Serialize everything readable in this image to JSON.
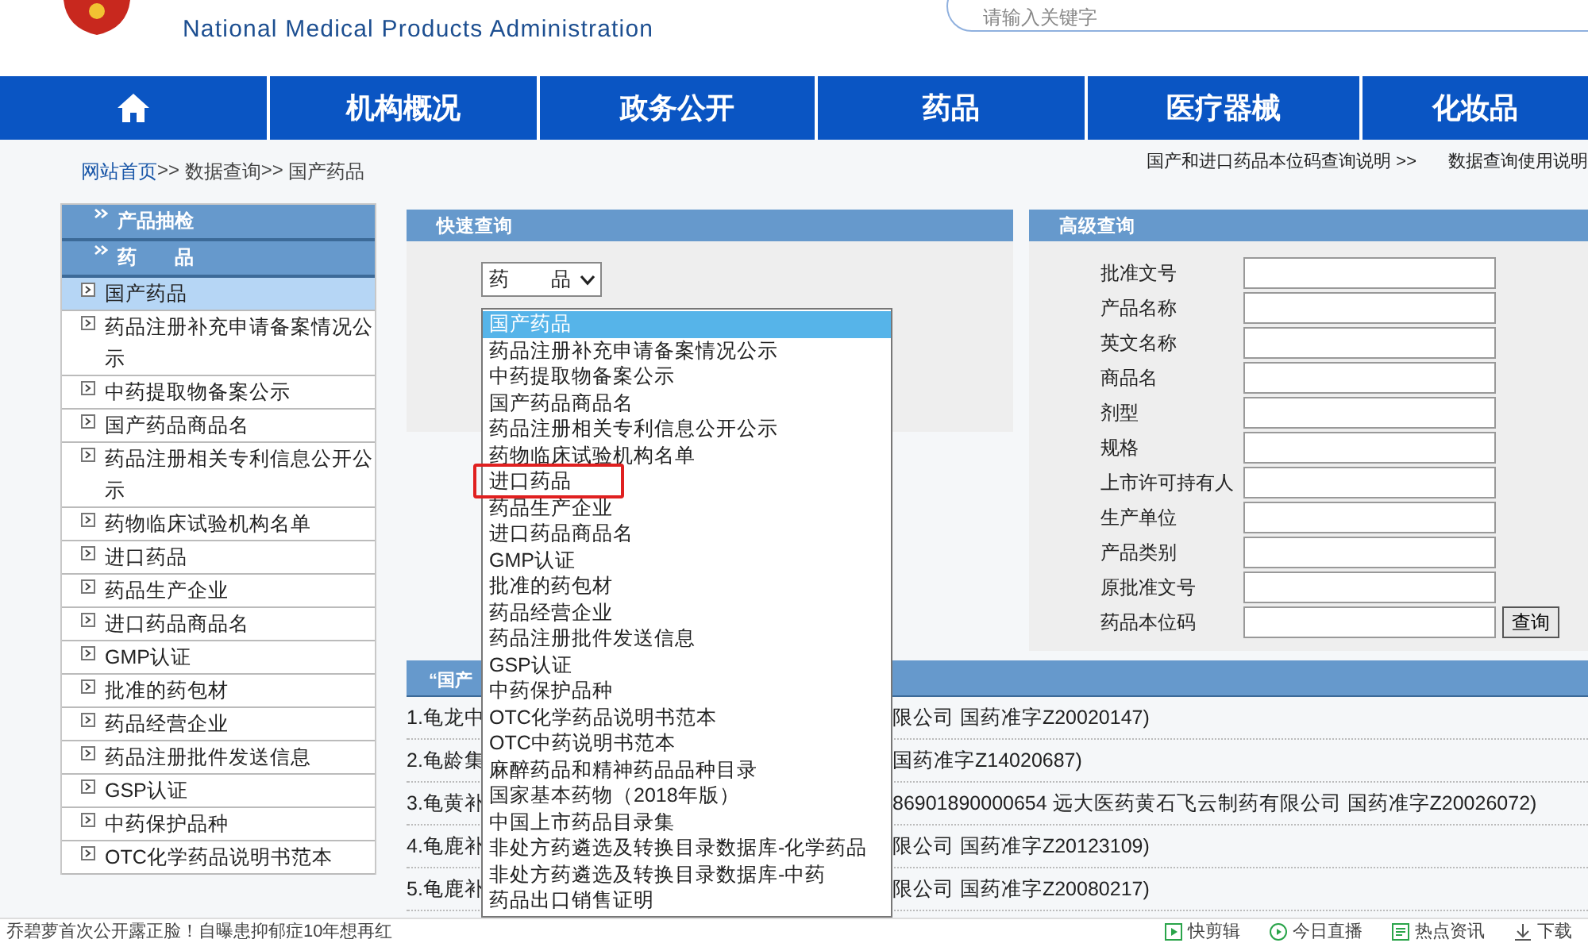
{
  "header": {
    "subtitle": "National Medical Products Administration",
    "search": {
      "placeholder": "请输入关键字"
    }
  },
  "nav": [
    {
      "kind": "home"
    },
    {
      "kind": "text",
      "label": "机构概况"
    },
    {
      "kind": "text",
      "label": "政务公开"
    },
    {
      "kind": "text",
      "label": "药品"
    },
    {
      "kind": "text",
      "label": "医疗器械"
    },
    {
      "kind": "text",
      "label": "化妆品"
    }
  ],
  "breadcrumb": {
    "separator": ">>",
    "items": [
      {
        "label": "网站首页",
        "link": true
      },
      {
        "label": "数据查询",
        "link": false
      },
      {
        "label": "国产药品",
        "link": false
      }
    ]
  },
  "help_links": [
    "国产和进口药品本位码查询说明 >>",
    "数据查询使用说明"
  ],
  "sidebar": {
    "sections": [
      "产品抽检",
      "药　　品"
    ],
    "items": [
      {
        "label": "国产药品",
        "selected": true
      },
      {
        "label": "药品注册补充申请备案情况公示",
        "selected": false
      },
      {
        "label": "中药提取物备案公示",
        "selected": false
      },
      {
        "label": "国产药品商品名",
        "selected": false
      },
      {
        "label": "药品注册相关专利信息公开公示",
        "selected": false
      },
      {
        "label": "药物临床试验机构名单",
        "selected": false
      },
      {
        "label": "进口药品",
        "selected": false
      },
      {
        "label": "药品生产企业",
        "selected": false
      },
      {
        "label": "进口药品商品名",
        "selected": false
      },
      {
        "label": "GMP认证",
        "selected": false
      },
      {
        "label": "批准的药包材",
        "selected": false
      },
      {
        "label": "药品经营企业",
        "selected": false
      },
      {
        "label": "药品注册批件发送信息",
        "selected": false
      },
      {
        "label": "GSP认证",
        "selected": false
      },
      {
        "label": "中药保护品种",
        "selected": false
      },
      {
        "label": "OTC化学药品说明书范本",
        "selected": false
      }
    ]
  },
  "quick_search": {
    "title": "快速查询",
    "select": {
      "value": "药　　品",
      "expanded": true
    },
    "options": [
      {
        "label": "国产药品",
        "selected": true,
        "marked": false
      },
      {
        "label": "药品注册补充申请备案情况公示",
        "selected": false,
        "marked": false
      },
      {
        "label": "中药提取物备案公示",
        "selected": false,
        "marked": false
      },
      {
        "label": "国产药品商品名",
        "selected": false,
        "marked": false
      },
      {
        "label": "药品注册相关专利信息公开公示",
        "selected": false,
        "marked": false
      },
      {
        "label": "药物临床试验机构名单",
        "selected": false,
        "marked": false
      },
      {
        "label": "进口药品",
        "selected": false,
        "marked": true
      },
      {
        "label": "药品生产企业",
        "selected": false,
        "marked": false
      },
      {
        "label": "进口药品商品名",
        "selected": false,
        "marked": false
      },
      {
        "label": "GMP认证",
        "selected": false,
        "marked": false
      },
      {
        "label": "批准的药包材",
        "selected": false,
        "marked": false
      },
      {
        "label": "药品经营企业",
        "selected": false,
        "marked": false
      },
      {
        "label": "药品注册批件发送信息",
        "selected": false,
        "marked": false
      },
      {
        "label": "GSP认证",
        "selected": false,
        "marked": false
      },
      {
        "label": "中药保护品种",
        "selected": false,
        "marked": false
      },
      {
        "label": "OTC化学药品说明书范本",
        "selected": false,
        "marked": false
      },
      {
        "label": "OTC中药说明书范本",
        "selected": false,
        "marked": false
      },
      {
        "label": "麻醉药品和精神药品品种目录",
        "selected": false,
        "marked": false
      },
      {
        "label": "国家基本药物（2018年版）",
        "selected": false,
        "marked": false
      },
      {
        "label": "中国上市药品目录集",
        "selected": false,
        "marked": false
      },
      {
        "label": "非处方药遴选及转换目录数据库-化学药品",
        "selected": false,
        "marked": false
      },
      {
        "label": "非处方药遴选及转换目录数据库-中药",
        "selected": false,
        "marked": false
      },
      {
        "label": "药品出口销售证明",
        "selected": false,
        "marked": false
      }
    ]
  },
  "advanced_search": {
    "title": "高级查询",
    "fields": [
      "批准文号",
      "产品名称",
      "英文名称",
      "商品名",
      "剂型",
      "规格",
      "上市许可持有人",
      "生产单位",
      "产品类别",
      "原批准文号",
      "药品本位码"
    ],
    "button": "查询"
  },
  "results": {
    "title": "“国产",
    "rows": [
      {
        "lead": "1.龟龙中",
        "tail": "限公司 国药准字Z20020147)"
      },
      {
        "lead": "2.龟龄集",
        "tail": "国药准字Z14020687)"
      },
      {
        "lead": "3.龟黄补",
        "tail": "86901890000654 远大医药黄石飞云制药有限公司 国药准字Z20026072)"
      },
      {
        "lead": "4.龟鹿补",
        "tail": "限公司 国药准字Z20123109)"
      },
      {
        "lead": "5.龟鹿补",
        "tail": "限公司 国药准字Z20080217)"
      }
    ]
  },
  "status_bar": {
    "news": "乔碧萝首次公开露正脸！自曝患抑郁症10年想再红",
    "items": [
      {
        "kind": "clip",
        "label": "快剪辑"
      },
      {
        "kind": "live",
        "label": "今日直播"
      },
      {
        "kind": "news",
        "label": "热点资讯"
      },
      {
        "kind": "download",
        "label": "下载"
      }
    ]
  }
}
